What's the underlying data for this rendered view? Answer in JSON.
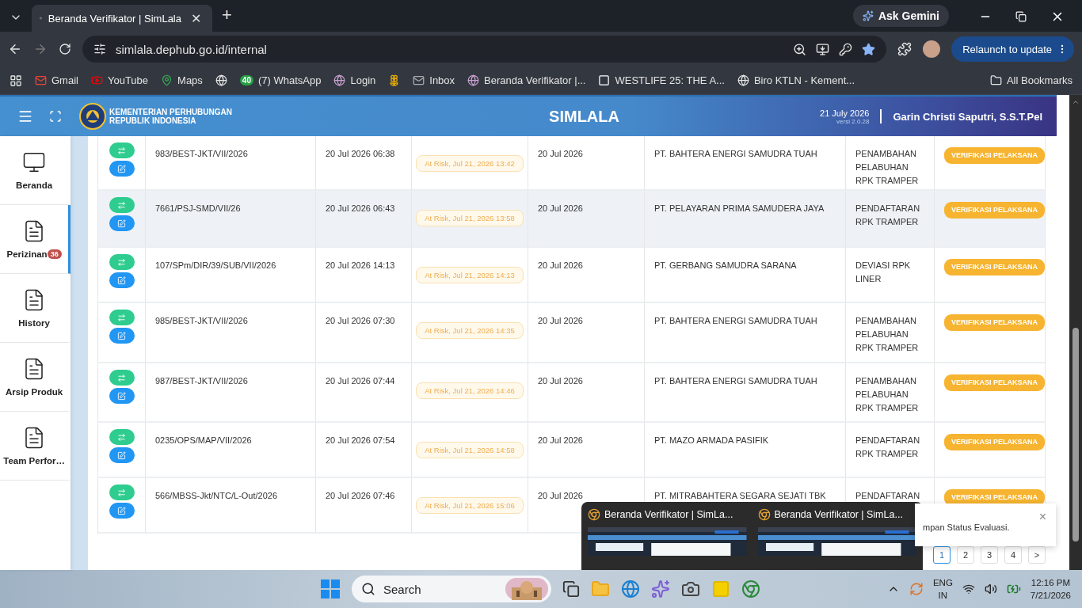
{
  "browser": {
    "tab": {
      "title": "Beranda Verifikator | SimLala",
      "close": "✕"
    },
    "new_tab": "+",
    "ask_gemini": "Ask Gemini",
    "address": "simlala.dephub.go.id/internal",
    "relaunch": "Relaunch to update",
    "bookmarks": [
      {
        "kind": "link",
        "label": "Gmail"
      },
      {
        "kind": "link",
        "label": "YouTube"
      },
      {
        "kind": "link",
        "label": "Maps"
      },
      {
        "kind": "icon"
      },
      {
        "kind": "link",
        "label": "(7) WhatsApp",
        "badge": "40"
      },
      {
        "kind": "link",
        "label": "Login"
      },
      {
        "kind": "icon"
      },
      {
        "kind": "link",
        "label": "Inbox"
      },
      {
        "kind": "link",
        "label": "Beranda Verifikator |..."
      },
      {
        "kind": "link",
        "label": "WESTLIFE 25: THE A..."
      },
      {
        "kind": "link",
        "label": "Biro KTLN - Kement..."
      }
    ],
    "all_bookmarks": "All Bookmarks"
  },
  "header": {
    "org_line_1": "KEMENTERIAN PERHUBUNGAN",
    "org_line_2": "REPUBLIK INDONESIA",
    "title": "SIMLALA",
    "date": "21 July 2026",
    "version": "versi 2.0.28",
    "user": "Garin Christi Saputri, S.S.T.Pel"
  },
  "sidebar": [
    {
      "label": "Beranda",
      "selected": false
    },
    {
      "label": "Perizinan",
      "selected": true,
      "badge": "36"
    },
    {
      "label": "History",
      "selected": false
    },
    {
      "label": "Arsip Produk",
      "selected": false
    },
    {
      "label": "Team Perfor…",
      "selected": false
    }
  ],
  "rows": [
    {
      "number": "983/BEST-JKT/VII/2026",
      "submitted": "20 Jul 2026 06:38",
      "deadline": "At Risk, Jul 21, 2026 13:42",
      "date": "20 Jul 2026",
      "company": "PT. BAHTERA ENERGI SAMUDRA TUAH",
      "type": "PENAMBAHAN PELABUHAN RPK TRAMPER",
      "status": "VERIFIKASI PELAKSANA",
      "hovered": false
    },
    {
      "number": "7661/PSJ-SMD/VII/26",
      "submitted": "20 Jul 2026 06:43",
      "deadline": "At Risk, Jul 21, 2026 13:58",
      "date": "20 Jul 2026",
      "company": "PT. PELAYARAN PRIMA SAMUDERA JAYA",
      "type": "PENDAFTARAN RPK TRAMPER",
      "status": "VERIFIKASI PELAKSANA",
      "hovered": true
    },
    {
      "number": "107/SPm/DIR/39/SUB/VII/2026",
      "submitted": "20 Jul 2026 14:13",
      "deadline": "At Risk, Jul 21, 2026 14:13",
      "date": "20 Jul 2026",
      "company": "PT. GERBANG SAMUDRA SARANA",
      "type": "DEVIASI RPK LINER",
      "status": "VERIFIKASI PELAKSANA",
      "hovered": false
    },
    {
      "number": "985/BEST-JKT/VII/2026",
      "submitted": "20 Jul 2026 07:30",
      "deadline": "At Risk, Jul 21, 2026 14:35",
      "date": "20 Jul 2026",
      "company": "PT. BAHTERA ENERGI SAMUDRA TUAH",
      "type": "PENAMBAHAN PELABUHAN RPK TRAMPER",
      "status": "VERIFIKASI PELAKSANA",
      "hovered": false
    },
    {
      "number": "987/BEST-JKT/VII/2026",
      "submitted": "20 Jul 2026 07:44",
      "deadline": "At Risk, Jul 21, 2026 14:46",
      "date": "20 Jul 2026",
      "company": "PT. BAHTERA ENERGI SAMUDRA TUAH",
      "type": "PENAMBAHAN PELABUHAN RPK TRAMPER",
      "status": "VERIFIKASI PELAKSANA",
      "hovered": false
    },
    {
      "number": "0235/OPS/MAP/VII/2026",
      "submitted": "20 Jul 2026 07:54",
      "deadline": "At Risk, Jul 21, 2026 14:58",
      "date": "20 Jul 2026",
      "company": "PT. MAZO ARMADA PASIFIK",
      "type": "PENDAFTARAN RPK TRAMPER",
      "status": "VERIFIKASI PELAKSANA",
      "hovered": false
    },
    {
      "number": "566/MBSS-Jkt/NTC/L-Out/2026",
      "submitted": "20 Jul 2026 07:46",
      "deadline": "At Risk, Jul 21, 2026 15:06",
      "date": "20 Jul 2026",
      "company": "PT. MITRABAHTERA SEGARA SEJATI TBK",
      "type": "PENDAFTARAN",
      "status": "VERIFIKASI PELAKSANA",
      "hovered": false
    }
  ],
  "pagination": {
    "pages": [
      {
        "label": "1",
        "selected": true
      },
      {
        "label": "2",
        "selected": false
      },
      {
        "label": "3",
        "selected": false
      },
      {
        "label": "4",
        "selected": false
      }
    ],
    "next": ">"
  },
  "toast": {
    "text": "mpan Status Evaluasi.",
    "close": "×"
  },
  "taskbar_preview": [
    {
      "title": "Beranda Verifikator | SimLa..."
    },
    {
      "title": "Beranda Verifikator | SimLa..."
    }
  ],
  "taskbar": {
    "search": "Search",
    "language": "ENG",
    "region": "IN",
    "time": "12:16 PM",
    "date": "7/21/2026"
  }
}
